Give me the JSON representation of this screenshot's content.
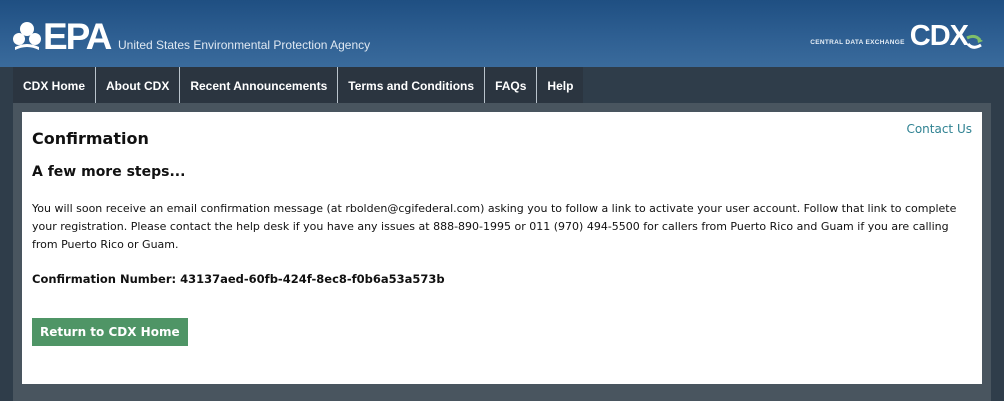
{
  "header": {
    "epa_logo_text": "EPA",
    "agency_name": "United States Environmental Protection Agency",
    "cdx_tagline": "CENTRAL DATA EXCHANGE",
    "cdx_logo_text": "CDX"
  },
  "nav": {
    "items": [
      {
        "label": "CDX Home"
      },
      {
        "label": "About CDX"
      },
      {
        "label": "Recent Announcements"
      },
      {
        "label": "Terms and Conditions"
      },
      {
        "label": "FAQs"
      },
      {
        "label": "Help"
      }
    ]
  },
  "main": {
    "contact_link": "Contact Us",
    "title": "Confirmation",
    "subtitle": "A few more steps...",
    "message": "You will soon receive an email confirmation message (at rbolden@cgifederal.com) asking you to follow a link to activate your user account. Follow that link to complete your registration. Please contact the help desk if you have any issues at 888-890-1995 or 011 (970) 494-5500 for callers from Puerto Rico and Guam if you are calling from Puerto Rico or Guam.",
    "confirmation_label": "Confirmation Number:",
    "confirmation_number": "43137aed-60fb-424f-8ec8-f0b6a53a573b",
    "return_button": "Return to CDX Home"
  },
  "colors": {
    "header_blue": "#2e5f92",
    "nav_dark": "#2b3540",
    "button_green": "#4f9566",
    "link_teal": "#2f8292"
  }
}
